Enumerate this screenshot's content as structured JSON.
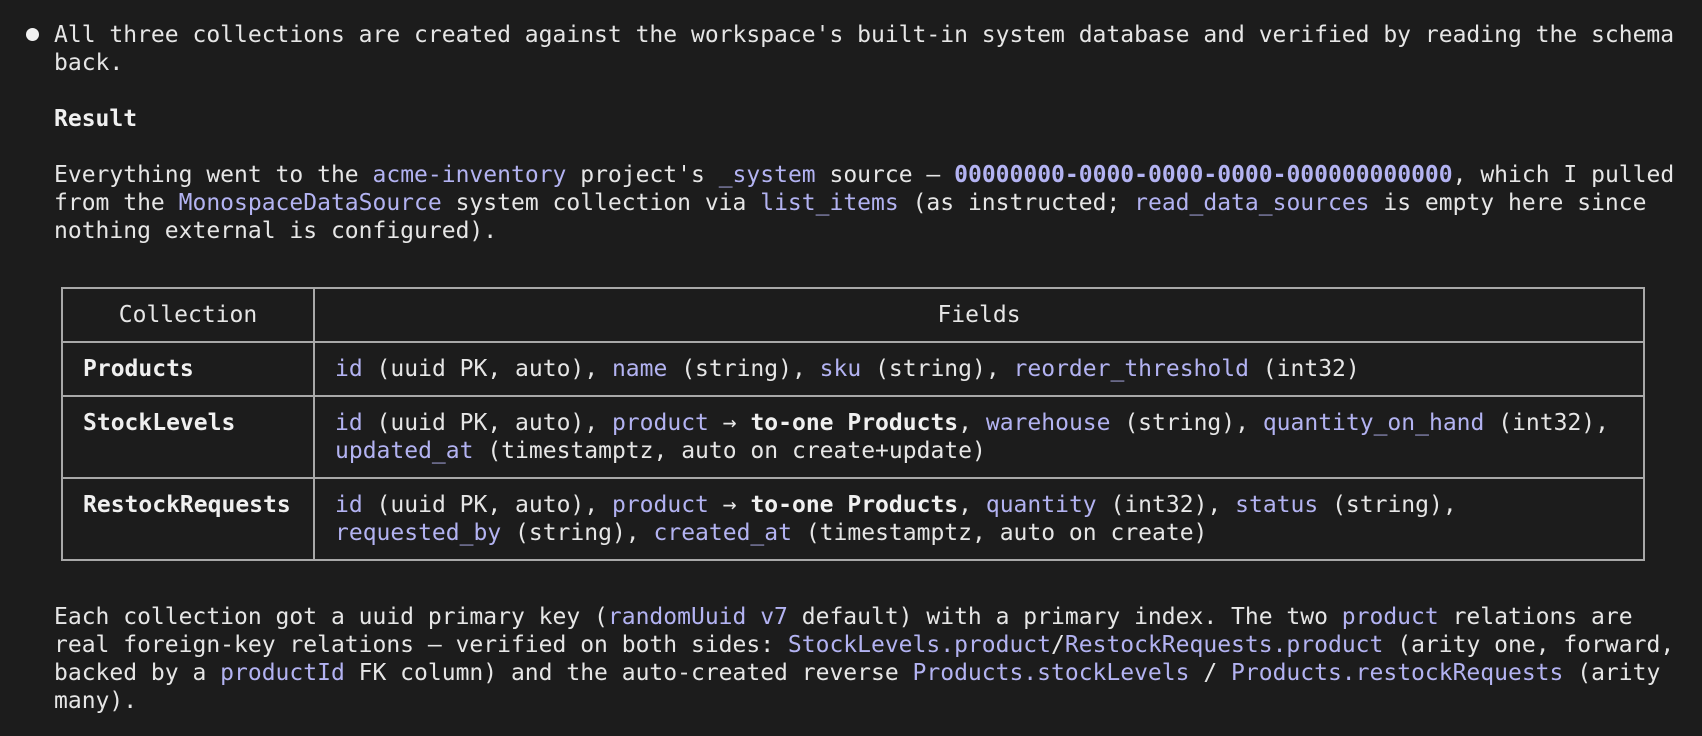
{
  "summary": {
    "intro": "All three collections are created against the workspace's built-in system database and verified by reading the schema back.",
    "result_heading": "Result"
  },
  "result_paragraph": {
    "t1": "Everything went to the ",
    "project": "acme-inventory",
    "t2": " project's ",
    "source": "_system",
    "t3": " source — ",
    "uuid": "00000000-0000-0000-0000-000000000000",
    "t4": ", which I pulled from the ",
    "ds_collection": "MonospaceDataSource",
    "t5": " system collection via ",
    "list_items": "list_items",
    "t6": " (as instructed; ",
    "read_ds": "read_data_sources",
    "t7": " is empty here since nothing external is configured)."
  },
  "table": {
    "headers": [
      "Collection",
      "Fields"
    ],
    "rows": [
      {
        "name": "Products",
        "fields": [
          {
            "field": "id",
            "desc": " (uuid PK, auto), "
          },
          {
            "field": "name",
            "desc": " (string), "
          },
          {
            "field": "sku",
            "desc": " (string), "
          },
          {
            "field": "reorder_threshold",
            "desc": " (int32)"
          }
        ]
      },
      {
        "name": "StockLevels",
        "fields": [
          {
            "field": "id",
            "desc": " (uuid PK, auto), "
          },
          {
            "field": "product",
            "desc": " → ",
            "strong": "to-one Products",
            "after": ", "
          },
          {
            "field": "warehouse",
            "desc": " (string), "
          },
          {
            "field": "quantity_on_hand",
            "desc": " (int32), "
          },
          {
            "field": "updated_at",
            "desc": " (timestamptz, auto on create+update)"
          }
        ]
      },
      {
        "name": "RestockRequests",
        "fields": [
          {
            "field": "id",
            "desc": " (uuid PK, auto), "
          },
          {
            "field": "product",
            "desc": " → ",
            "strong": "to-one Products",
            "after": ", "
          },
          {
            "field": "quantity",
            "desc": " (int32), "
          },
          {
            "field": "status",
            "desc": " (string), "
          },
          {
            "field": "requested_by",
            "desc": " (string), "
          },
          {
            "field": "created_at",
            "desc": " (timestamptz, auto on create)"
          }
        ]
      }
    ]
  },
  "closing_paragraph": {
    "t1": "Each collection got a uuid primary key (",
    "uuid_default": "randomUuid v7",
    "t2": " default) with a primary index. The two ",
    "product": "product",
    "t3": " relations are real foreign-key relations — verified on both sides: ",
    "sl_product": "StockLevels.product",
    "slash1": "/",
    "rr_product": "RestockRequests.product",
    "t4": " (arity one, forward, backed by a ",
    "product_id": "productId",
    "t5": " FK column) and the auto-created reverse ",
    "p_stock": "Products.stockLevels",
    "slash2": " / ",
    "p_restock": "Products.restockRequests",
    "t6": " (arity many)."
  }
}
